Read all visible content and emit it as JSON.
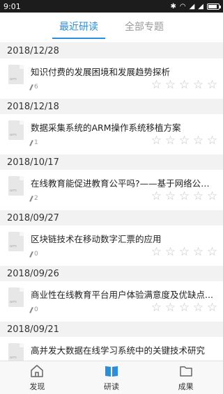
{
  "status_bar": {
    "time": "9:01"
  },
  "tabs": [
    {
      "label": "最近研读"
    },
    {
      "label": "全部专题"
    }
  ],
  "groups": [
    {
      "date": "2018/12/28",
      "items": [
        {
          "title": "知识付费的发展困境和发展趋势探析",
          "count": "6"
        }
      ]
    },
    {
      "date": "2018/12/18",
      "items": [
        {
          "title": "数据采集系统的ARM操作系统移植方案",
          "count": "1"
        }
      ]
    },
    {
      "date": "2018/10/17",
      "items": [
        {
          "title": "在线教育能促进教育公平吗?——基于网络公选...",
          "count": "2"
        }
      ]
    },
    {
      "date": "2018/09/27",
      "items": [
        {
          "title": "区块链技术在移动数字汇票的应用",
          "count": "0"
        }
      ]
    },
    {
      "date": "2018/09/26",
      "items": [
        {
          "title": "商业性在线教育平台用户体验满意度及优缺点...",
          "count": "0"
        }
      ]
    },
    {
      "date": "2018/09/21",
      "items": [
        {
          "title": "高并发大数据在线学习系统中的关键技术研究",
          "count": ""
        }
      ]
    }
  ],
  "doc_icon_text": "arm",
  "star_glyph": "☆",
  "bottom_nav": [
    {
      "label": "发现",
      "icon": "home-icon"
    },
    {
      "label": "研读",
      "icon": "book-icon"
    },
    {
      "label": "成果",
      "icon": "folder-icon"
    }
  ],
  "colors": {
    "accent": "#2a8ee0",
    "inactive": "#999999",
    "star": "#c4c4c4"
  }
}
